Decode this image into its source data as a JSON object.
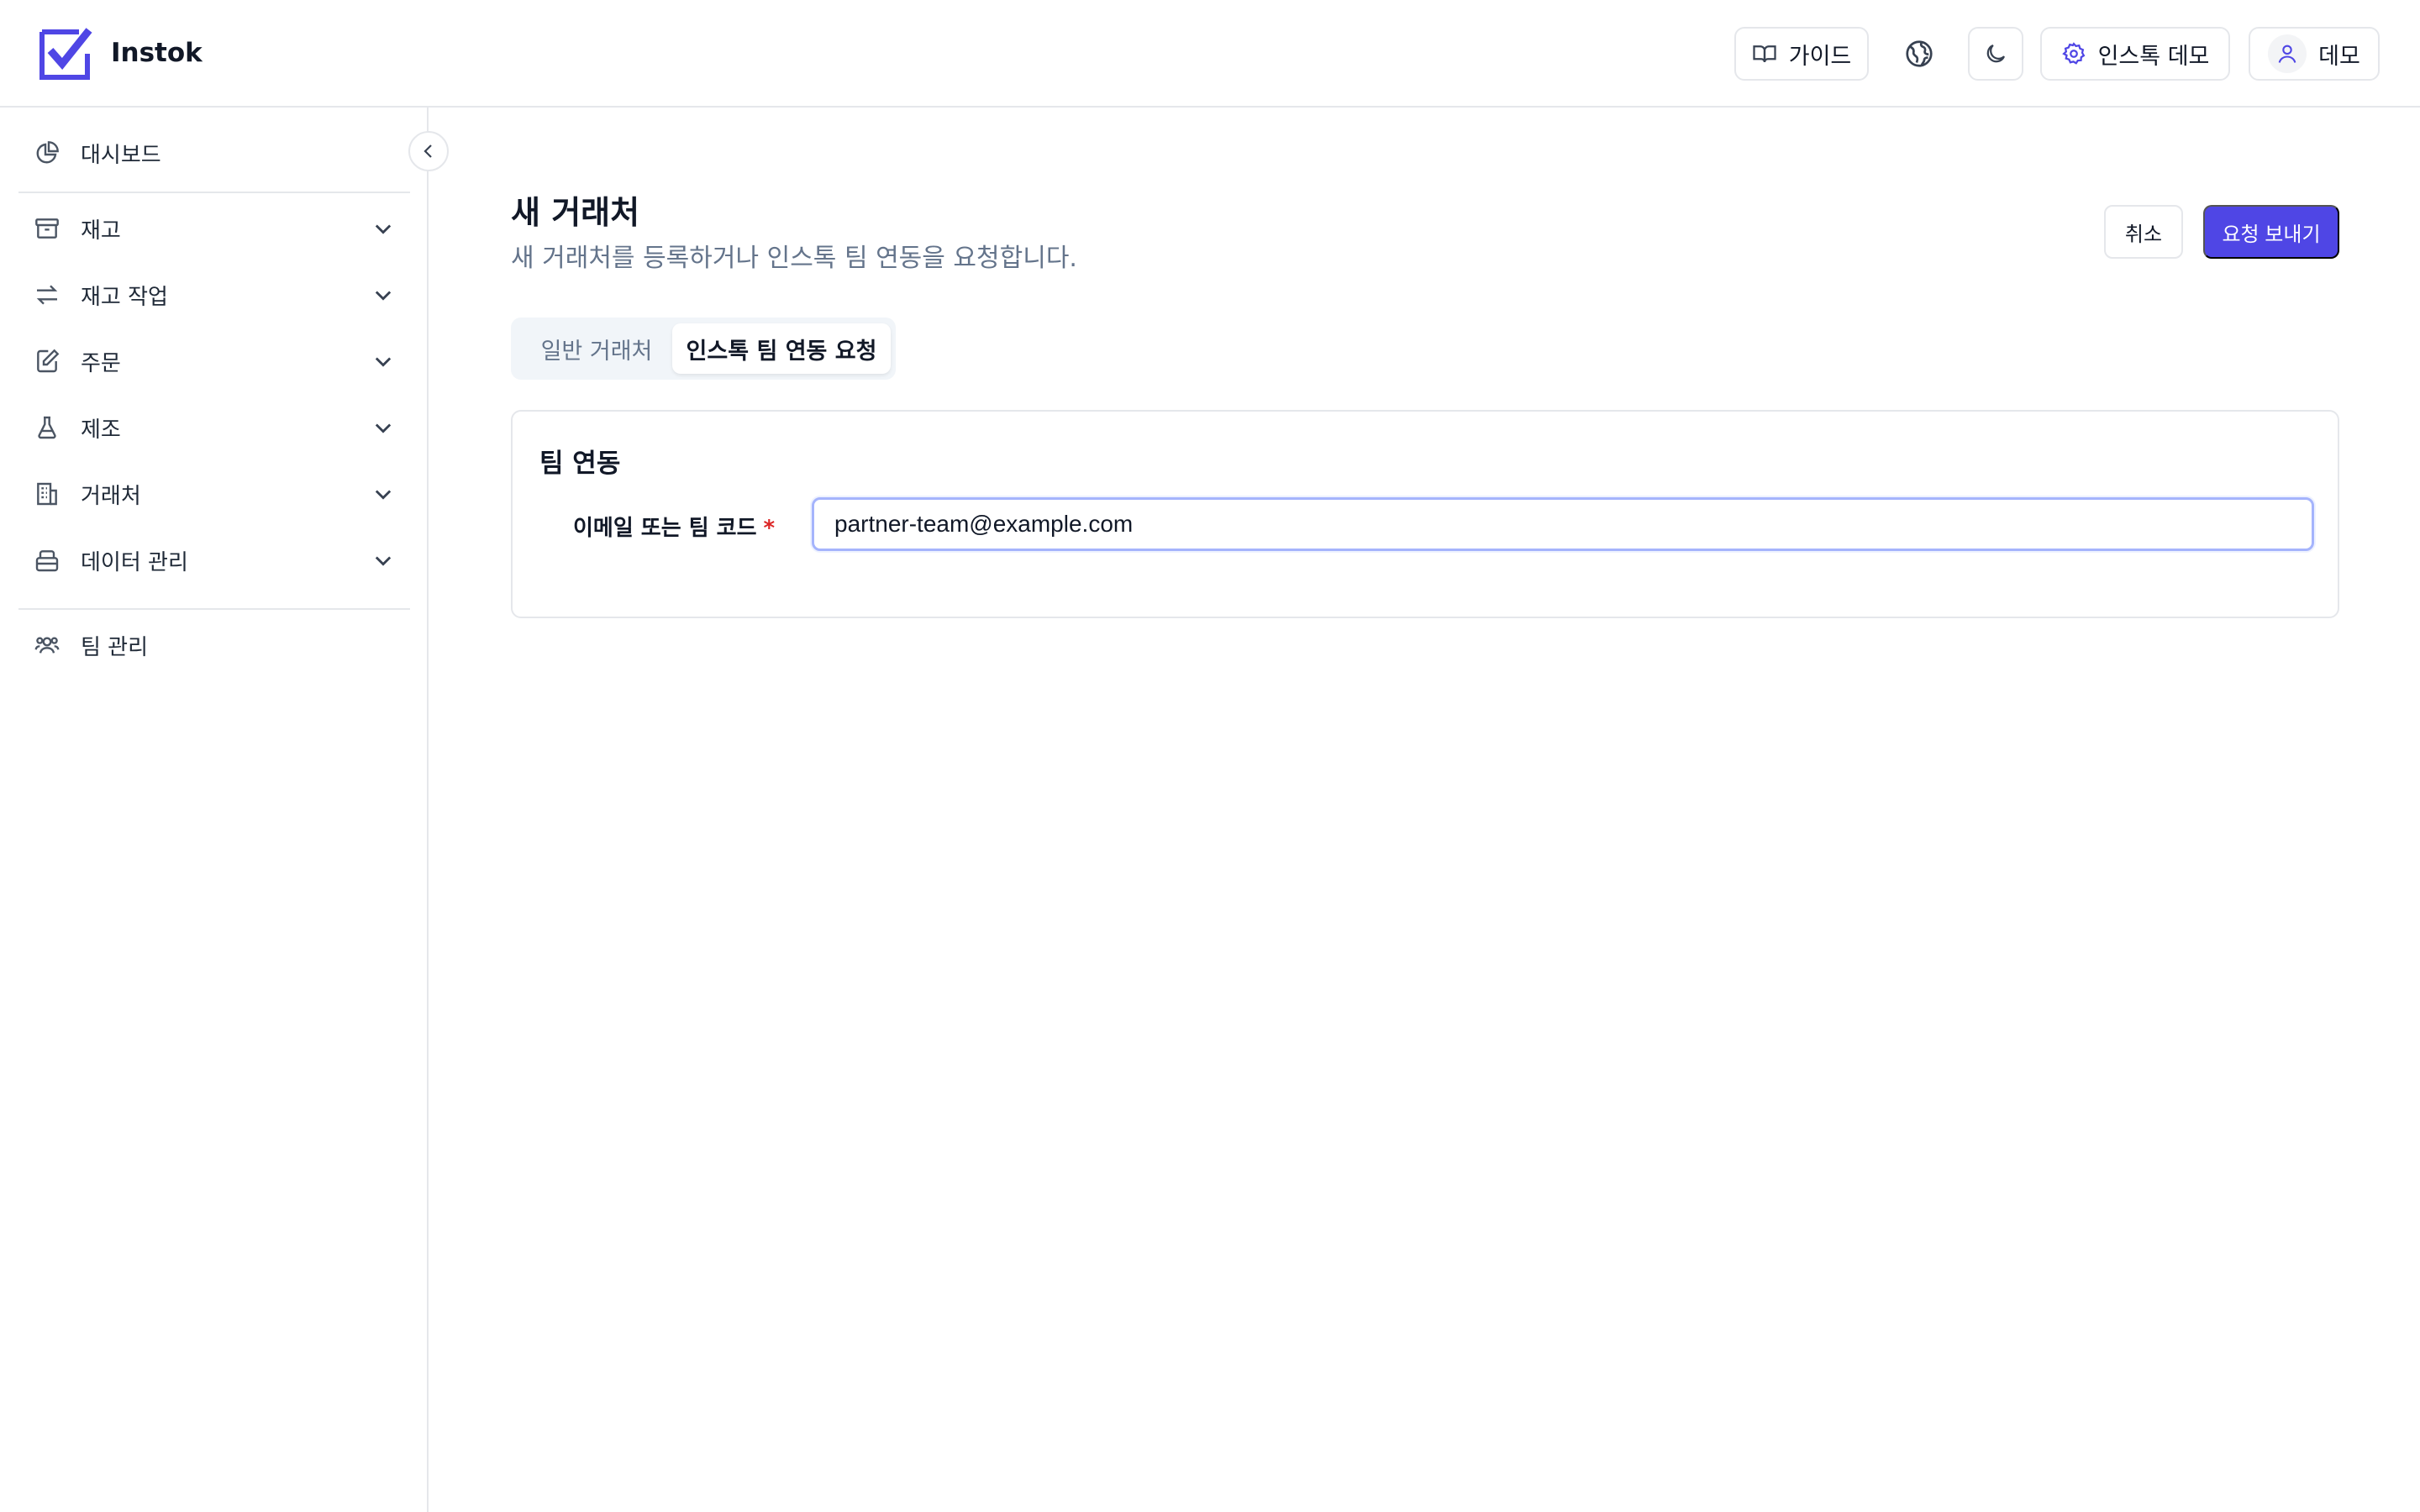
{
  "brand": {
    "name": "Instok",
    "accent": "#4f46e5"
  },
  "header": {
    "guide_label": "가이드",
    "language_icon": "globe-icon",
    "theme_icon": "moon-icon",
    "team_label": "인스톡 데모",
    "user_label": "데모"
  },
  "sidebar": {
    "items": [
      {
        "label": "대시보드",
        "icon": "pie-chart-icon",
        "expandable": false
      },
      {
        "label": "재고",
        "icon": "archive-icon",
        "expandable": true
      },
      {
        "label": "재고 작업",
        "icon": "arrows-swap-icon",
        "expandable": true
      },
      {
        "label": "주문",
        "icon": "edit-document-icon",
        "expandable": true
      },
      {
        "label": "제조",
        "icon": "flask-icon",
        "expandable": true
      },
      {
        "label": "거래처",
        "icon": "building-icon",
        "expandable": true
      },
      {
        "label": "데이터 관리",
        "icon": "database-icon",
        "expandable": true
      },
      {
        "label": "팀 관리",
        "icon": "users-icon",
        "expandable": false
      }
    ]
  },
  "page": {
    "title": "새 거래처",
    "subtitle": "새 거래처를 등록하거나 인스톡 팀 연동을 요청합니다.",
    "cancel_label": "취소",
    "submit_label": "요청 보내기"
  },
  "tabs": {
    "general_label": "일반 거래처",
    "link_label": "인스톡 팀 연동 요청",
    "active": "link"
  },
  "card": {
    "title": "팀 연동",
    "field_label": "이메일 또는 팀 코드",
    "required_mark": "*",
    "field_value": "partner-team@example.com"
  }
}
